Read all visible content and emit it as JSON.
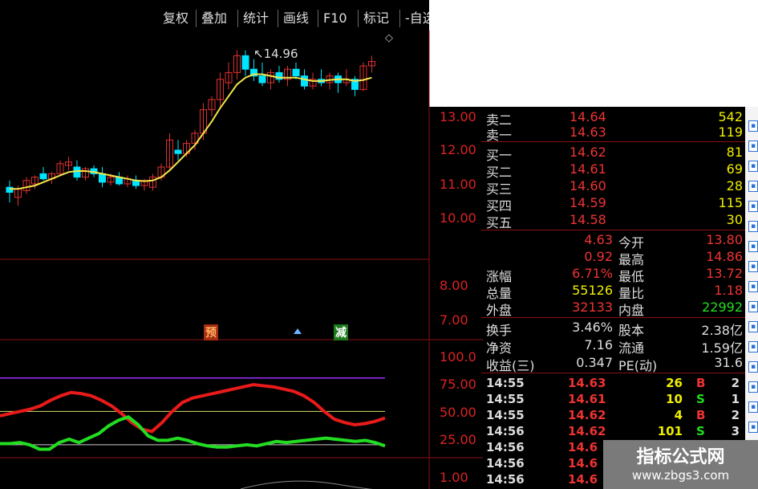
{
  "toolbar": {
    "buttons": [
      "复权",
      "叠加",
      "统计",
      "画线",
      "F10",
      "标记",
      "-自选"
    ]
  },
  "chart": {
    "price_axis": [
      "13.00",
      "12.00",
      "11.00",
      "10.00"
    ],
    "volume_axis": [
      "8.00",
      "7.00"
    ],
    "indicator_axis": [
      "100.0",
      "75.00",
      "50.00",
      "25.00"
    ],
    "lower_axis": [
      "1.00"
    ],
    "high_marker": "14.96",
    "signals": [
      "预",
      "减"
    ],
    "colors": {
      "up": "#e03030",
      "down": "#00e5ff",
      "ma": "#f2e64a",
      "k_line": "#e81a1a",
      "d_line": "#22dd22"
    }
  },
  "chart_data": {
    "type": "candlestick",
    "ylim": [
      9.7,
      15.2
    ],
    "candles": [
      {
        "o": 10.9,
        "h": 11.1,
        "l": 10.45,
        "c": 10.75
      },
      {
        "o": 10.6,
        "h": 10.95,
        "l": 10.35,
        "c": 10.85
      },
      {
        "o": 10.8,
        "h": 11.2,
        "l": 10.7,
        "c": 11.1
      },
      {
        "o": 11.0,
        "h": 11.25,
        "l": 10.85,
        "c": 11.2
      },
      {
        "o": 11.3,
        "h": 11.5,
        "l": 11.1,
        "c": 11.15
      },
      {
        "o": 11.15,
        "h": 11.35,
        "l": 11.0,
        "c": 11.3
      },
      {
        "o": 11.3,
        "h": 11.7,
        "l": 11.25,
        "c": 11.6
      },
      {
        "o": 11.55,
        "h": 11.8,
        "l": 11.4,
        "c": 11.65
      },
      {
        "o": 11.5,
        "h": 11.7,
        "l": 11.1,
        "c": 11.2
      },
      {
        "o": 11.2,
        "h": 11.5,
        "l": 11.1,
        "c": 11.45
      },
      {
        "o": 11.45,
        "h": 11.55,
        "l": 11.2,
        "c": 11.3
      },
      {
        "o": 11.3,
        "h": 11.5,
        "l": 10.9,
        "c": 11.05
      },
      {
        "o": 11.05,
        "h": 11.3,
        "l": 10.95,
        "c": 11.2
      },
      {
        "o": 11.2,
        "h": 11.35,
        "l": 10.95,
        "c": 11.0
      },
      {
        "o": 11.0,
        "h": 11.25,
        "l": 10.9,
        "c": 11.15
      },
      {
        "o": 11.1,
        "h": 11.25,
        "l": 10.85,
        "c": 10.95
      },
      {
        "o": 10.95,
        "h": 11.15,
        "l": 10.8,
        "c": 11.1
      },
      {
        "o": 10.9,
        "h": 11.3,
        "l": 10.8,
        "c": 11.2
      },
      {
        "o": 11.2,
        "h": 11.6,
        "l": 11.1,
        "c": 11.5
      },
      {
        "o": 11.5,
        "h": 12.5,
        "l": 11.4,
        "c": 12.3
      },
      {
        "o": 12.0,
        "h": 12.3,
        "l": 11.7,
        "c": 11.9
      },
      {
        "o": 11.9,
        "h": 12.3,
        "l": 11.8,
        "c": 12.2
      },
      {
        "o": 12.2,
        "h": 12.6,
        "l": 12.0,
        "c": 12.5
      },
      {
        "o": 12.5,
        "h": 13.4,
        "l": 12.3,
        "c": 13.2
      },
      {
        "o": 13.2,
        "h": 13.6,
        "l": 13.0,
        "c": 13.5
      },
      {
        "o": 13.5,
        "h": 14.3,
        "l": 13.3,
        "c": 14.1
      },
      {
        "o": 14.0,
        "h": 14.6,
        "l": 13.8,
        "c": 14.3
      },
      {
        "o": 14.3,
        "h": 14.96,
        "l": 14.1,
        "c": 14.8
      },
      {
        "o": 14.8,
        "h": 14.96,
        "l": 14.2,
        "c": 14.4
      },
      {
        "o": 14.4,
        "h": 14.7,
        "l": 14.05,
        "c": 14.2
      },
      {
        "o": 14.2,
        "h": 14.6,
        "l": 13.9,
        "c": 14.0
      },
      {
        "o": 14.0,
        "h": 14.4,
        "l": 13.8,
        "c": 14.3
      },
      {
        "o": 14.3,
        "h": 14.5,
        "l": 14.0,
        "c": 14.1
      },
      {
        "o": 14.1,
        "h": 14.5,
        "l": 13.9,
        "c": 14.4
      },
      {
        "o": 14.4,
        "h": 14.6,
        "l": 14.1,
        "c": 14.2
      },
      {
        "o": 14.2,
        "h": 14.4,
        "l": 13.8,
        "c": 13.9
      },
      {
        "o": 13.9,
        "h": 14.3,
        "l": 13.8,
        "c": 14.1
      },
      {
        "o": 14.1,
        "h": 14.4,
        "l": 13.9,
        "c": 14.0
      },
      {
        "o": 14.0,
        "h": 14.3,
        "l": 13.8,
        "c": 14.2
      },
      {
        "o": 14.2,
        "h": 14.3,
        "l": 13.7,
        "c": 14.0
      },
      {
        "o": 14.0,
        "h": 14.4,
        "l": 13.9,
        "c": 14.1
      },
      {
        "o": 14.1,
        "h": 14.2,
        "l": 13.6,
        "c": 13.8
      },
      {
        "o": 13.8,
        "h": 14.6,
        "l": 13.75,
        "c": 14.5
      },
      {
        "o": 14.5,
        "h": 14.8,
        "l": 14.3,
        "c": 14.63
      }
    ],
    "ma": [
      10.85,
      10.85,
      10.9,
      10.95,
      11.05,
      11.15,
      11.25,
      11.35,
      11.38,
      11.38,
      11.35,
      11.3,
      11.25,
      11.2,
      11.15,
      11.1,
      11.08,
      11.1,
      11.2,
      11.4,
      11.65,
      11.9,
      12.15,
      12.5,
      12.85,
      13.25,
      13.6,
      13.95,
      14.15,
      14.25,
      14.25,
      14.2,
      14.15,
      14.15,
      14.15,
      14.1,
      14.05,
      14.05,
      14.08,
      14.1,
      14.1,
      14.05,
      14.08,
      14.15
    ],
    "k": [
      46,
      48,
      50,
      52,
      55,
      60,
      64,
      67,
      66,
      64,
      60,
      55,
      48,
      40,
      34,
      32,
      40,
      50,
      58,
      62,
      64,
      66,
      68,
      70,
      72,
      74,
      73,
      72,
      70,
      68,
      64,
      58,
      50,
      43,
      40,
      38,
      39,
      41,
      44
    ],
    "d": [
      21,
      21,
      22,
      20,
      16,
      16,
      22,
      25,
      22,
      26,
      30,
      37,
      42,
      45,
      38,
      28,
      24,
      24,
      26,
      24,
      21,
      19,
      18,
      18,
      19,
      20,
      19,
      21,
      23,
      22,
      23,
      24,
      25,
      26,
      25,
      24,
      23,
      24,
      22,
      19
    ]
  },
  "orderbook": {
    "rows": [
      {
        "label": "卖二",
        "price": "14.64",
        "vol": "542"
      },
      {
        "label": "卖一",
        "price": "14.63",
        "vol": "119"
      },
      {
        "label": "买一",
        "price": "14.62",
        "vol": "81"
      },
      {
        "label": "买二",
        "price": "14.61",
        "vol": "69"
      },
      {
        "label": "买三",
        "price": "14.60",
        "vol": "28"
      },
      {
        "label": "买四",
        "price": "14.59",
        "vol": "115"
      },
      {
        "label": "买五",
        "price": "14.58",
        "vol": "30"
      }
    ]
  },
  "stats": [
    {
      "l1": "",
      "v1": "4.63",
      "c1": "#e33",
      "l2": "今开",
      "v2": "13.80",
      "c2": "#e33"
    },
    {
      "l1": "",
      "v1": "0.92",
      "c1": "#e33",
      "l2": "最高",
      "v2": "14.86",
      "c2": "#e33"
    },
    {
      "l1": "涨幅",
      "v1": "6.71%",
      "c1": "#e33",
      "l2": "最低",
      "v2": "13.72",
      "c2": "#e33"
    },
    {
      "l1": "总量",
      "v1": "55126",
      "c1": "#ee0",
      "l2": "量比",
      "v2": "1.18",
      "c2": "#e33"
    },
    {
      "l1": "外盘",
      "v1": "32133",
      "c1": "#e33",
      "l2": "内盘",
      "v2": "22992",
      "c2": "#2d2"
    },
    {
      "l1": "换手",
      "v1": "3.46%",
      "c1": "#ddd",
      "l2": "股本",
      "v2": "2.38亿",
      "c2": "#ddd"
    },
    {
      "l1": "净资",
      "v1": "7.16",
      "c1": "#ddd",
      "l2": "流通",
      "v2": "1.59亿",
      "c2": "#ddd"
    },
    {
      "l1": "收益(三)",
      "v1": "0.347",
      "c1": "#ddd",
      "l2": "PE(动)",
      "v2": "31.6",
      "c2": "#ddd"
    }
  ],
  "ticks": [
    {
      "time": "14:55",
      "price": "14.63",
      "vol": "26",
      "dir": "B",
      "dcol": "#e33",
      "n": "2"
    },
    {
      "time": "14:55",
      "price": "14.61",
      "vol": "10",
      "dir": "S",
      "dcol": "#2d2",
      "n": "1"
    },
    {
      "time": "14:55",
      "price": "14.62",
      "vol": "4",
      "dir": "B",
      "dcol": "#e33",
      "n": "2"
    },
    {
      "time": "14:56",
      "price": "14.62",
      "vol": "101",
      "dir": "S",
      "dcol": "#2d2",
      "n": "3"
    },
    {
      "time": "14:56",
      "price": "14.6",
      "vol": "",
      "dir": "",
      "dcol": "#ddd",
      "n": ""
    },
    {
      "time": "14:56",
      "price": "14.6",
      "vol": "",
      "dir": "",
      "dcol": "#ddd",
      "n": ""
    },
    {
      "time": "14:56",
      "price": "14.6",
      "vol": "",
      "dir": "",
      "dcol": "#ddd",
      "n": ""
    }
  ],
  "watermark": {
    "line1": "指标公式网",
    "line2": "www.zbgs3.com"
  }
}
